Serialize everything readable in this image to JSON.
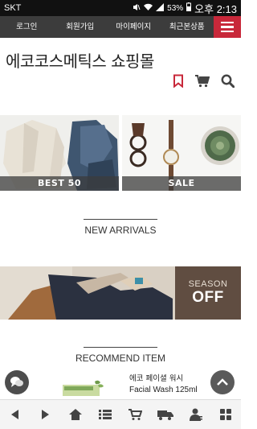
{
  "status_bar": {
    "carrier": "SKT",
    "battery": "53%",
    "time": "오후 2:13",
    "icons": [
      "mute-icon",
      "wifi-icon",
      "signal-icon",
      "battery-icon"
    ]
  },
  "top_nav": {
    "items": [
      {
        "label": "로그인"
      },
      {
        "label": "회원가입"
      },
      {
        "label": "마이페이지"
      },
      {
        "label": "최근본상품"
      }
    ],
    "menu_icon": "hamburger-menu-icon"
  },
  "shop": {
    "title": "에코코스메틱스 쇼핑몰"
  },
  "tools": {
    "icons": [
      "bookmark-icon",
      "cart-icon",
      "search-icon"
    ]
  },
  "banners": [
    {
      "label": "BEST 50"
    },
    {
      "label": "SALE"
    }
  ],
  "sections": {
    "new_arrivals": "NEW ARRIVALS",
    "recommend": "RECOMMEND ITEM"
  },
  "season_banner": {
    "line1": "SEASON",
    "line2": "OFF"
  },
  "product": {
    "name_ko": "에코 페이셜 워시",
    "name_en": "Facial Wash 125ml"
  },
  "bottom_bar": {
    "icons": [
      "back-arrow-icon",
      "forward-arrow-icon",
      "home-icon",
      "list-icon",
      "cart-icon",
      "delivery-truck-icon",
      "member-icon",
      "grid-icon"
    ]
  },
  "colors": {
    "nav_bg": "#3c3c3c",
    "accent": "#c8283a",
    "status_bg": "#111111"
  }
}
